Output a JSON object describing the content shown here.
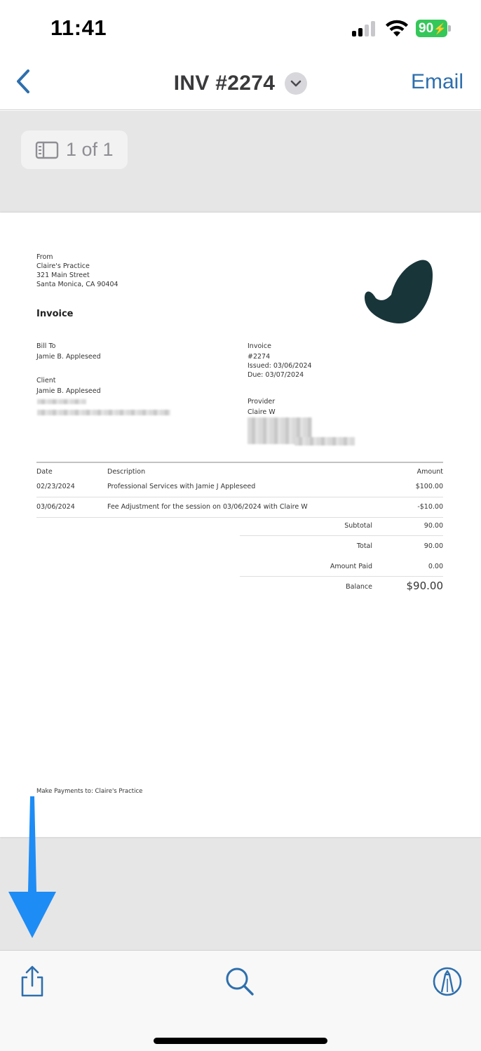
{
  "status_bar": {
    "time": "11:41",
    "battery": "90"
  },
  "nav": {
    "back_label": "Back",
    "title": "INV #2274",
    "email_label": "Email"
  },
  "viewer": {
    "page_indicator": "1 of 1"
  },
  "invoice": {
    "from_label": "From",
    "from_lines": [
      "Claire's Practice",
      "321 Main Street",
      "Santa Monica, CA 90404"
    ],
    "heading": "Invoice",
    "bill_to_label": "Bill To",
    "bill_to_name": "Jamie B. Appleseed",
    "client_label": "Client",
    "client_name": "Jamie B. Appleseed",
    "invoice_label": "Invoice",
    "invoice_number": "#2274",
    "issued": "Issued: 03/06/2024",
    "due": "Due: 03/07/2024",
    "provider_label": "Provider",
    "provider_name": "Claire W",
    "columns": {
      "date": "Date",
      "description": "Description",
      "amount": "Amount"
    },
    "items": [
      {
        "date": "02/23/2024",
        "description": "Professional Services with Jamie J Appleseed",
        "amount": "$100.00"
      },
      {
        "date": "03/06/2024",
        "description": "Fee Adjustment for the session on 03/06/2024 with Claire W",
        "amount": "-$10.00"
      }
    ],
    "totals": [
      {
        "label": "Subtotal",
        "value": "90.00"
      },
      {
        "label": "Total",
        "value": "90.00"
      },
      {
        "label": "Amount Paid",
        "value": "0.00"
      },
      {
        "label": "Balance",
        "value": "$90.00"
      }
    ],
    "footer": "Make Payments to: Claire's Practice",
    "logo_color": "#18353a"
  },
  "toolbar": {
    "share": "share-icon",
    "search": "search-icon",
    "markup": "markup-icon"
  },
  "colors": {
    "accent": "#2e6fad",
    "annotation_arrow": "#1e8cf5",
    "battery": "#34c759"
  }
}
